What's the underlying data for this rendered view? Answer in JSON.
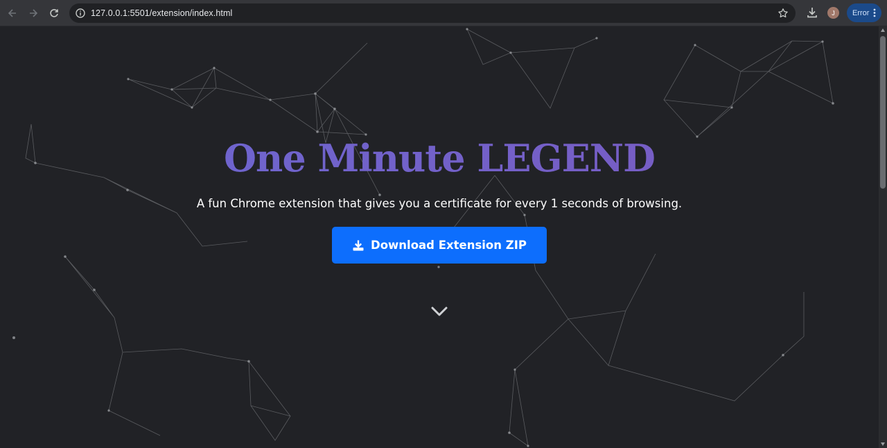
{
  "browser": {
    "url": "127.0.0.1:5501/extension/index.html",
    "profile_initial": "J",
    "error_label": "Error",
    "icons": {
      "back": "arrow-left-icon",
      "forward": "arrow-right-icon",
      "reload": "reload-icon",
      "site_info": "info-icon",
      "bookmark": "star-icon",
      "downloads": "download-icon",
      "menu": "kebab-menu-icon"
    }
  },
  "hero": {
    "title": "One Minute LEGEND",
    "subtitle": "A fun Chrome extension that gives you a certificate for every 1 seconds of browsing.",
    "download_button_label": "Download Extension ZIP",
    "download_icon": "download-icon",
    "scroll_icon": "chevron-down-icon"
  },
  "colors": {
    "background": "#212226",
    "title_gradient_start": "#6b68d2",
    "title_gradient_end": "#7a5ac0",
    "button": "#0d6efd",
    "network_line": "#8a8c90"
  }
}
